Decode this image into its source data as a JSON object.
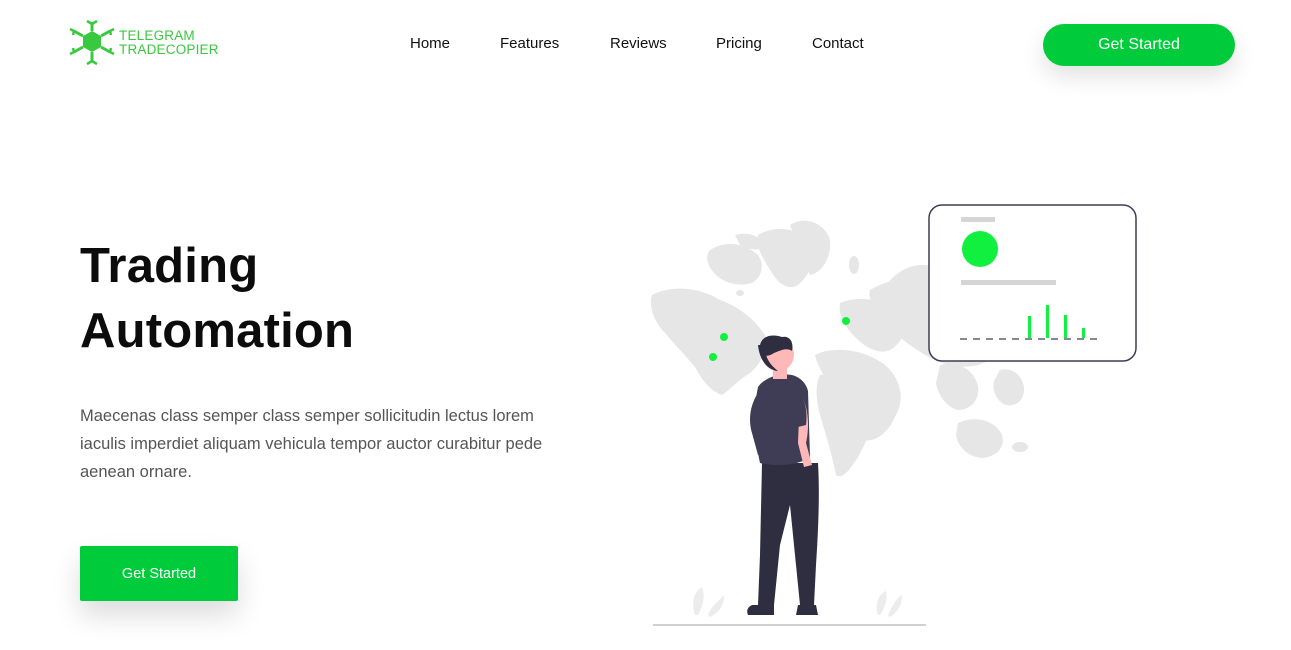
{
  "brand": {
    "line1": "TELEGRAM",
    "line2": "TRADECOPIER",
    "color": "#39c93f",
    "logo_icon": "network-hexagon-icon"
  },
  "nav": {
    "items": [
      {
        "label": "Home"
      },
      {
        "label": "Features"
      },
      {
        "label": "Reviews"
      },
      {
        "label": "Pricing"
      },
      {
        "label": "Contact"
      }
    ]
  },
  "header": {
    "cta_label": "Get Started"
  },
  "hero": {
    "title_line1": "Trading",
    "title_line2": "Automation",
    "description": "Maecenas class semper class semper sollicitudin lectus lorem iaculis imperdiet aliquam vehicula tempor auctor curabitur pede aenean ornare.",
    "cta_label": "Get Started"
  },
  "illustration": {
    "description_icon": "person-world-map-dashboard-icon"
  },
  "colors": {
    "accent": "#00cc3b",
    "marker": "#12f03f",
    "person_shirt": "#3f3d56",
    "person_pants": "#2f2e41",
    "map": "#e6e6e6"
  }
}
